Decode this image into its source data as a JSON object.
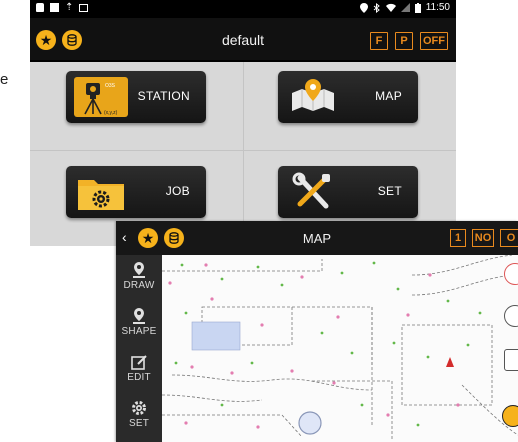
{
  "side_letter": "e",
  "status_bar": {
    "time": "11:50"
  },
  "main": {
    "title": "default",
    "buttons": {
      "f": "F",
      "p": "P",
      "off": "OFF"
    },
    "tiles": [
      {
        "label": "STATION",
        "icon": "total-station-icon",
        "icon_text_top": "O3S",
        "icon_text_bottom": "(x,y,z)"
      },
      {
        "label": "MAP",
        "icon": "map-icon"
      },
      {
        "label": "JOB",
        "icon": "folder-gear-icon"
      },
      {
        "label": "SET",
        "icon": "tools-icon"
      }
    ]
  },
  "map_screen": {
    "title": "MAP",
    "buttons": {
      "one": "1",
      "no": "NO",
      "clipped": "O"
    },
    "tools": [
      {
        "label": "DRAW",
        "icon": "pin-icon"
      },
      {
        "label": "SHAPE",
        "icon": "shape-pin-icon"
      },
      {
        "label": "EDIT",
        "icon": "edit-icon"
      },
      {
        "label": "SET",
        "icon": "gear-icon"
      }
    ]
  },
  "colors": {
    "accent_orange": "#e98a1e",
    "accent_yellow": "#f6b21b",
    "bar_dark": "#111111",
    "tile_bg": "#d8d8d8"
  }
}
